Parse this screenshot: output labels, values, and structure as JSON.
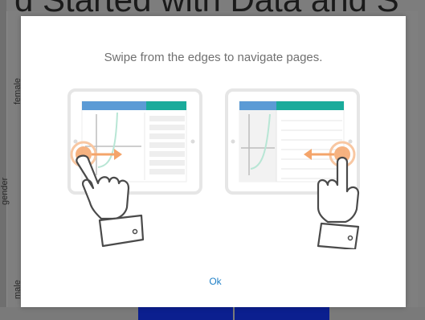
{
  "background": {
    "title": "d Started with Data and S",
    "axis_label_top": "female",
    "axis_label_mid": "gender",
    "axis_label_bottom": "male"
  },
  "dialog": {
    "message": "Swipe from the edges to navigate pages.",
    "ok_label": "Ok",
    "left_illustration": "swipe-right-from-left-edge-icon",
    "right_illustration": "swipe-left-from-right-edge-icon"
  },
  "colors": {
    "header_blue": "#5b9bd5",
    "header_teal": "#1aab9b",
    "touch_orange": "#f4a46a",
    "ok_blue": "#1e7fc6",
    "bar_navy": "#0b1f8f"
  }
}
